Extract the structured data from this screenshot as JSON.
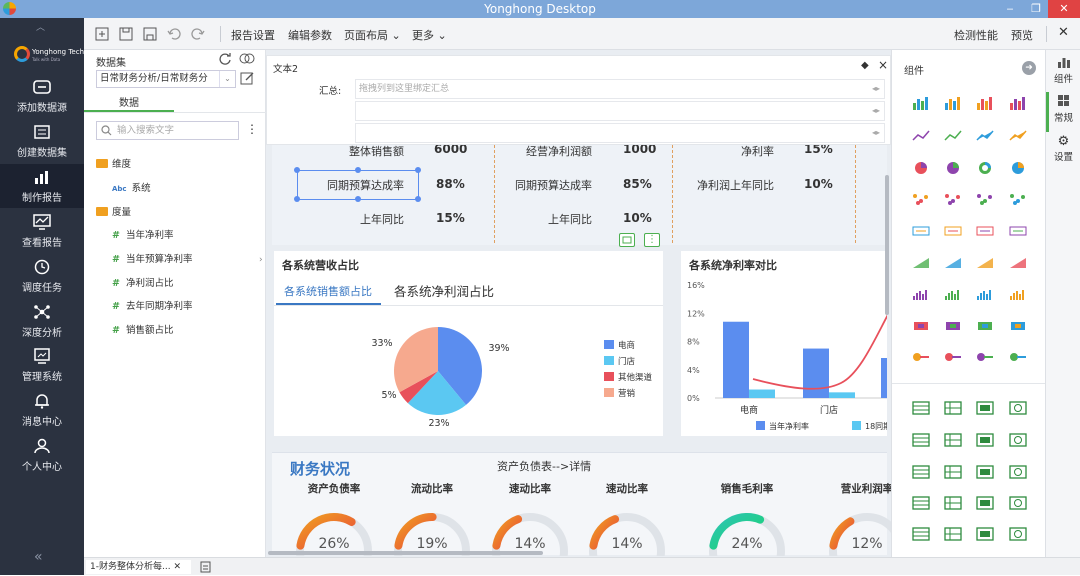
{
  "window": {
    "title": "Yonghong Desktop",
    "min": "‒",
    "max": "❐",
    "close": "✕"
  },
  "brand": {
    "name": "Yonghong Tech",
    "slogan": "Talk with Data"
  },
  "nav": [
    {
      "label": "添加数据源",
      "icon": "link-icon"
    },
    {
      "label": "创建数据集",
      "icon": "dataset-icon"
    },
    {
      "label": "制作报告",
      "icon": "bar-chart-icon"
    },
    {
      "label": "查看报告",
      "icon": "view-report-icon"
    },
    {
      "label": "调度任务",
      "icon": "clock-icon"
    },
    {
      "label": "深度分析",
      "icon": "network-icon"
    },
    {
      "label": "管理系统",
      "icon": "manage-icon"
    },
    {
      "label": "消息中心",
      "icon": "bell-icon"
    },
    {
      "label": "个人中心",
      "icon": "user-icon"
    }
  ],
  "toolbar": {
    "report_settings": "报告设置",
    "edit_params": "编辑参数",
    "page_layout": "页面布局",
    "more": "更多",
    "check_perf": "检测性能",
    "preview": "预览",
    "close": "✕"
  },
  "datapanel": {
    "title": "数据集",
    "dataset": "日常财务分析/日常财务分",
    "tab": "数据",
    "search_placeholder": "输入搜索文字",
    "dim_folder": "维度",
    "dim_system": "系统",
    "measure_folder": "度量",
    "measures": [
      "当年净利率",
      "当年预算净利率",
      "净利润占比",
      "去年同期净利率",
      "销售额占比"
    ]
  },
  "textbar": {
    "title": "文本2",
    "summary_label": "汇总:",
    "summary_placeholder": "拖拽列到这里绑定汇总"
  },
  "kpi": {
    "c1": [
      {
        "label": "整体销售额",
        "value": "6000"
      },
      {
        "label": "同期预算达成率",
        "value": "88%"
      },
      {
        "label": "上年同比",
        "value": "15%"
      }
    ],
    "c2": [
      {
        "label": "经营净利润额",
        "value": "1000"
      },
      {
        "label": "同期预算达成率",
        "value": "85%"
      },
      {
        "label": "上年同比",
        "value": "10%"
      }
    ],
    "c3": [
      {
        "label": "净利率",
        "value": "15%"
      },
      {
        "label": "净利润上年同比",
        "value": "10%"
      }
    ]
  },
  "pie_card": {
    "title": "各系统营收占比",
    "tab_active": "各系统销售额占比",
    "tab_other": "各系统净利润占比"
  },
  "bar_card": {
    "title": "各系统净利率对比"
  },
  "fin": {
    "title": "财务状况",
    "link": "资产负债表-->详情"
  },
  "gauges": [
    {
      "label": "资产负债率",
      "value": "26%",
      "frac": 0.26
    },
    {
      "label": "流动比率",
      "value": "19%",
      "frac": 0.19
    },
    {
      "label": "速动比率",
      "value": "14%",
      "frac": 0.14
    },
    {
      "label": "速动比率",
      "value": "14%",
      "frac": 0.14
    },
    {
      "label": "销售毛利率",
      "value": "24%",
      "frac": 0.24
    },
    {
      "label": "营业利润率",
      "value": "12%",
      "frac": 0.12
    }
  ],
  "components": {
    "title": "组件"
  },
  "right_tabs": [
    "组件",
    "常规",
    "设置"
  ],
  "status": {
    "tab": "1-财务整体分析每...",
    "close": "✕"
  },
  "colors": {
    "blue": "#5b8def",
    "cyan": "#5bc8f2",
    "red": "#e8505b",
    "peach": "#f6a98e",
    "accent": "#4caf50",
    "nav": "#2b3240"
  },
  "chart_data": [
    {
      "type": "pie",
      "title": "各系统销售额占比",
      "categories": [
        "电商",
        "门店",
        "其他渠道",
        "营销"
      ],
      "values": [
        39,
        23,
        5,
        33
      ],
      "labels": [
        "39%",
        "23%",
        "5%",
        "33%"
      ],
      "legend": "right"
    },
    {
      "type": "bar",
      "title": "各系统净利率对比",
      "categories": [
        "电商",
        "门店"
      ],
      "ylim": [
        0,
        16
      ],
      "yticks": [
        "16%",
        "12%",
        "8%",
        "4%",
        "0%"
      ],
      "series": [
        {
          "name": "当年净利率",
          "values": [
            10.8,
            7
          ]
        },
        {
          "name": "18同期净",
          "values": [
            1.2,
            0.8
          ]
        }
      ],
      "legend": "bottom"
    }
  ]
}
